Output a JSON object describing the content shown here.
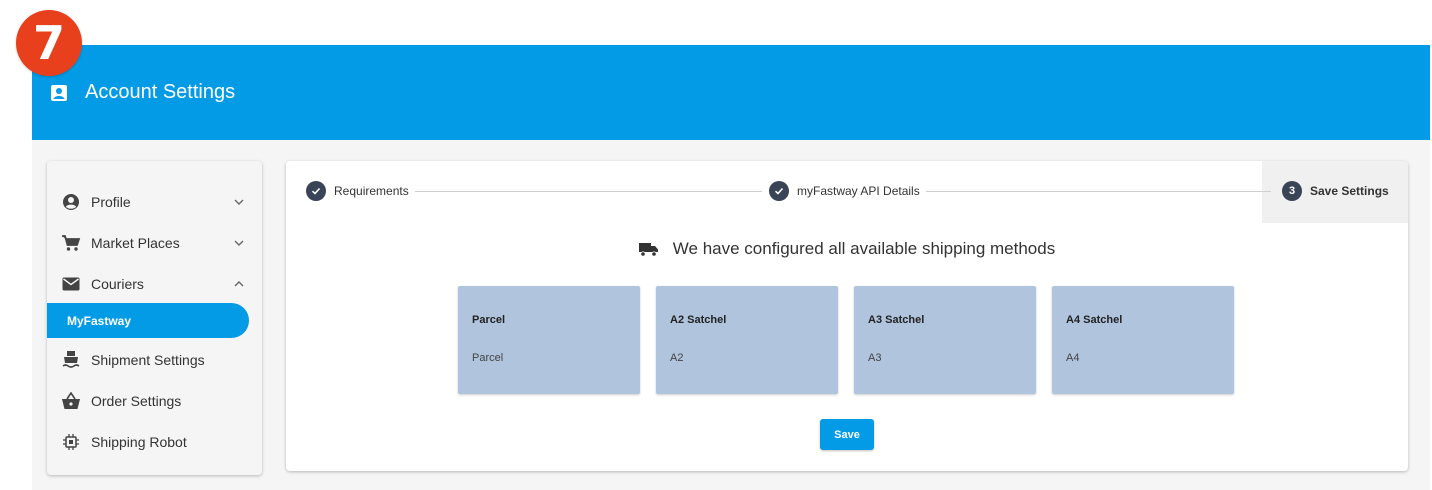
{
  "step_marker": "7",
  "header": {
    "title": "Account Settings",
    "icon": "account-box-icon"
  },
  "sidebar": {
    "items": [
      {
        "label": "Profile",
        "icon": "account-circle-icon",
        "chevron": "down"
      },
      {
        "label": "Market Places",
        "icon": "cart-icon",
        "chevron": "down"
      },
      {
        "label": "Couriers",
        "icon": "mail-icon",
        "chevron": "up"
      },
      {
        "label": "Shipment Settings",
        "icon": "ship-icon"
      },
      {
        "label": "Order Settings",
        "icon": "basket-icon"
      },
      {
        "label": "Shipping Robot",
        "icon": "chip-icon"
      }
    ],
    "active_sub": "MyFastway"
  },
  "stepper": {
    "steps": [
      {
        "label": "Requirements",
        "state": "done"
      },
      {
        "label": "myFastway API Details",
        "state": "done"
      },
      {
        "label": "Save Settings",
        "number": "3",
        "state": "active"
      }
    ]
  },
  "main": {
    "headline": "We have configured all available shipping methods",
    "methods": [
      {
        "name": "Parcel",
        "code": "Parcel"
      },
      {
        "name": "A2 Satchel",
        "code": "A2"
      },
      {
        "name": "A3 Satchel",
        "code": "A3"
      },
      {
        "name": "A4 Satchel",
        "code": "A4"
      }
    ],
    "save_label": "Save"
  },
  "colors": {
    "primary": "#039be5",
    "badge": "#e8401c",
    "card": "#b0c4de",
    "step_circle": "#3a4457"
  }
}
